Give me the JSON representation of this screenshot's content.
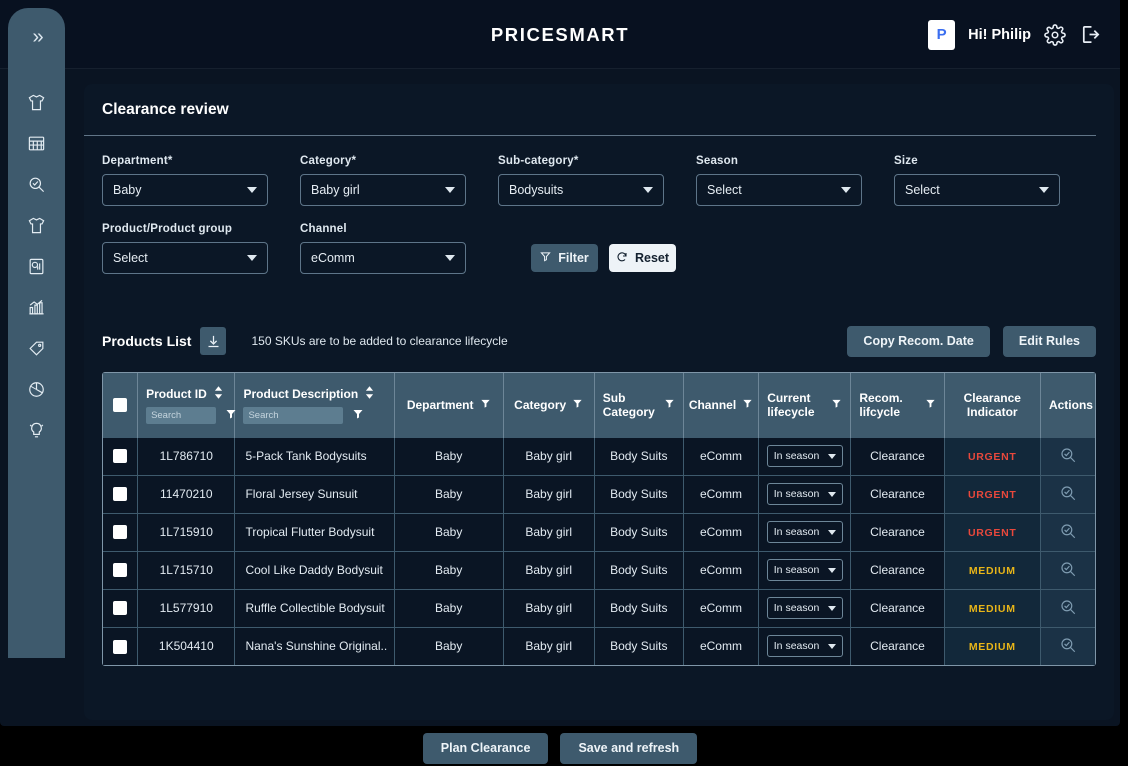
{
  "topbar": {
    "brand": "PRICESMART",
    "avatar_initial": "P",
    "greeting": "Hi! Philip",
    "settings_icon": "gear-icon",
    "logout_icon": "logout-icon"
  },
  "sidebar": {
    "toggle_icon": "double-chevron-right-icon",
    "items": [
      {
        "icon": "tshirt-icon"
      },
      {
        "icon": "calendar-grid-icon"
      },
      {
        "icon": "search-check-icon"
      },
      {
        "icon": "tshirt-outline-icon"
      },
      {
        "icon": "report-document-icon"
      },
      {
        "icon": "bar-chart-trend-icon"
      },
      {
        "icon": "price-tag-icon"
      },
      {
        "icon": "pie-chart-icon"
      },
      {
        "icon": "lightbulb-idea-icon"
      }
    ]
  },
  "page": {
    "title": "Clearance review"
  },
  "filters": {
    "fields": [
      {
        "label": "Department*",
        "value": "Baby"
      },
      {
        "label": "Category*",
        "value": "Baby girl"
      },
      {
        "label": "Sub-category*",
        "value": "Bodysuits"
      },
      {
        "label": "Season",
        "value": "Select"
      },
      {
        "label": "Size",
        "value": "Select"
      }
    ],
    "fields_row2": [
      {
        "label": "Product/Product group",
        "value": "Select"
      },
      {
        "label": "Channel",
        "value": "eComm"
      }
    ],
    "filter_button": "Filter",
    "reset_button": "Reset",
    "filter_icon": "funnel-icon",
    "reset_icon": "refresh-icon"
  },
  "products": {
    "list_title": "Products List",
    "download_icon": "download-icon",
    "note": "150 SKUs are to be added to clearance lifecycle",
    "copy_button": "Copy Recom. Date",
    "edit_button": "Edit Rules",
    "search_placeholder": "Search",
    "columns": [
      "Product ID",
      "Product Description",
      "Department",
      "Category",
      "Sub Category",
      "Channel",
      "Current lifecycle",
      "Recom. lifcycle",
      "Clearance Indicator",
      "Actions"
    ],
    "rows": [
      {
        "product_id": "1L786710",
        "description": "5-Pack Tank Bodysuits",
        "department": "Baby",
        "category": "Baby girl",
        "sub_category": "Body Suits",
        "channel": "eComm",
        "current_lifecycle": "In season",
        "recom_lifecycle": "Clearance",
        "indicator": "URGENT"
      },
      {
        "product_id": "11470210",
        "description": "Floral Jersey Sunsuit",
        "department": "Baby",
        "category": "Baby girl",
        "sub_category": "Body Suits",
        "channel": "eComm",
        "current_lifecycle": "In season",
        "recom_lifecycle": "Clearance",
        "indicator": "URGENT"
      },
      {
        "product_id": "1L715910",
        "description": "Tropical Flutter Bodysuit",
        "department": "Baby",
        "category": "Baby girl",
        "sub_category": "Body Suits",
        "channel": "eComm",
        "current_lifecycle": "In season",
        "recom_lifecycle": "Clearance",
        "indicator": "URGENT"
      },
      {
        "product_id": "1L715710",
        "description": "Cool Like Daddy Bodysuit",
        "department": "Baby",
        "category": "Baby girl",
        "sub_category": "Body Suits",
        "channel": "eComm",
        "current_lifecycle": "In season",
        "recom_lifecycle": "Clearance",
        "indicator": "MEDIUM"
      },
      {
        "product_id": "1L577910",
        "description": "Ruffle Collectible Bodysuit",
        "department": "Baby",
        "category": "Baby girl",
        "sub_category": "Body Suits",
        "channel": "eComm",
        "current_lifecycle": "In season",
        "recom_lifecycle": "Clearance",
        "indicator": "MEDIUM"
      },
      {
        "product_id": "1K504410",
        "description": "Nana's Sunshine Original..",
        "department": "Baby",
        "category": "Baby girl",
        "sub_category": "Body Suits",
        "channel": "eComm",
        "current_lifecycle": "In season",
        "recom_lifecycle": "Clearance",
        "indicator": "MEDIUM"
      }
    ]
  },
  "footer": {
    "plan_button": "Plan Clearance",
    "save_button": "Save and refresh"
  },
  "colors": {
    "accent_slate": "#3e5a6d",
    "card_bg": "#0b1726",
    "urgent": "#e8483c",
    "medium": "#e8b518",
    "brand_blue": "#3b6ef0"
  }
}
